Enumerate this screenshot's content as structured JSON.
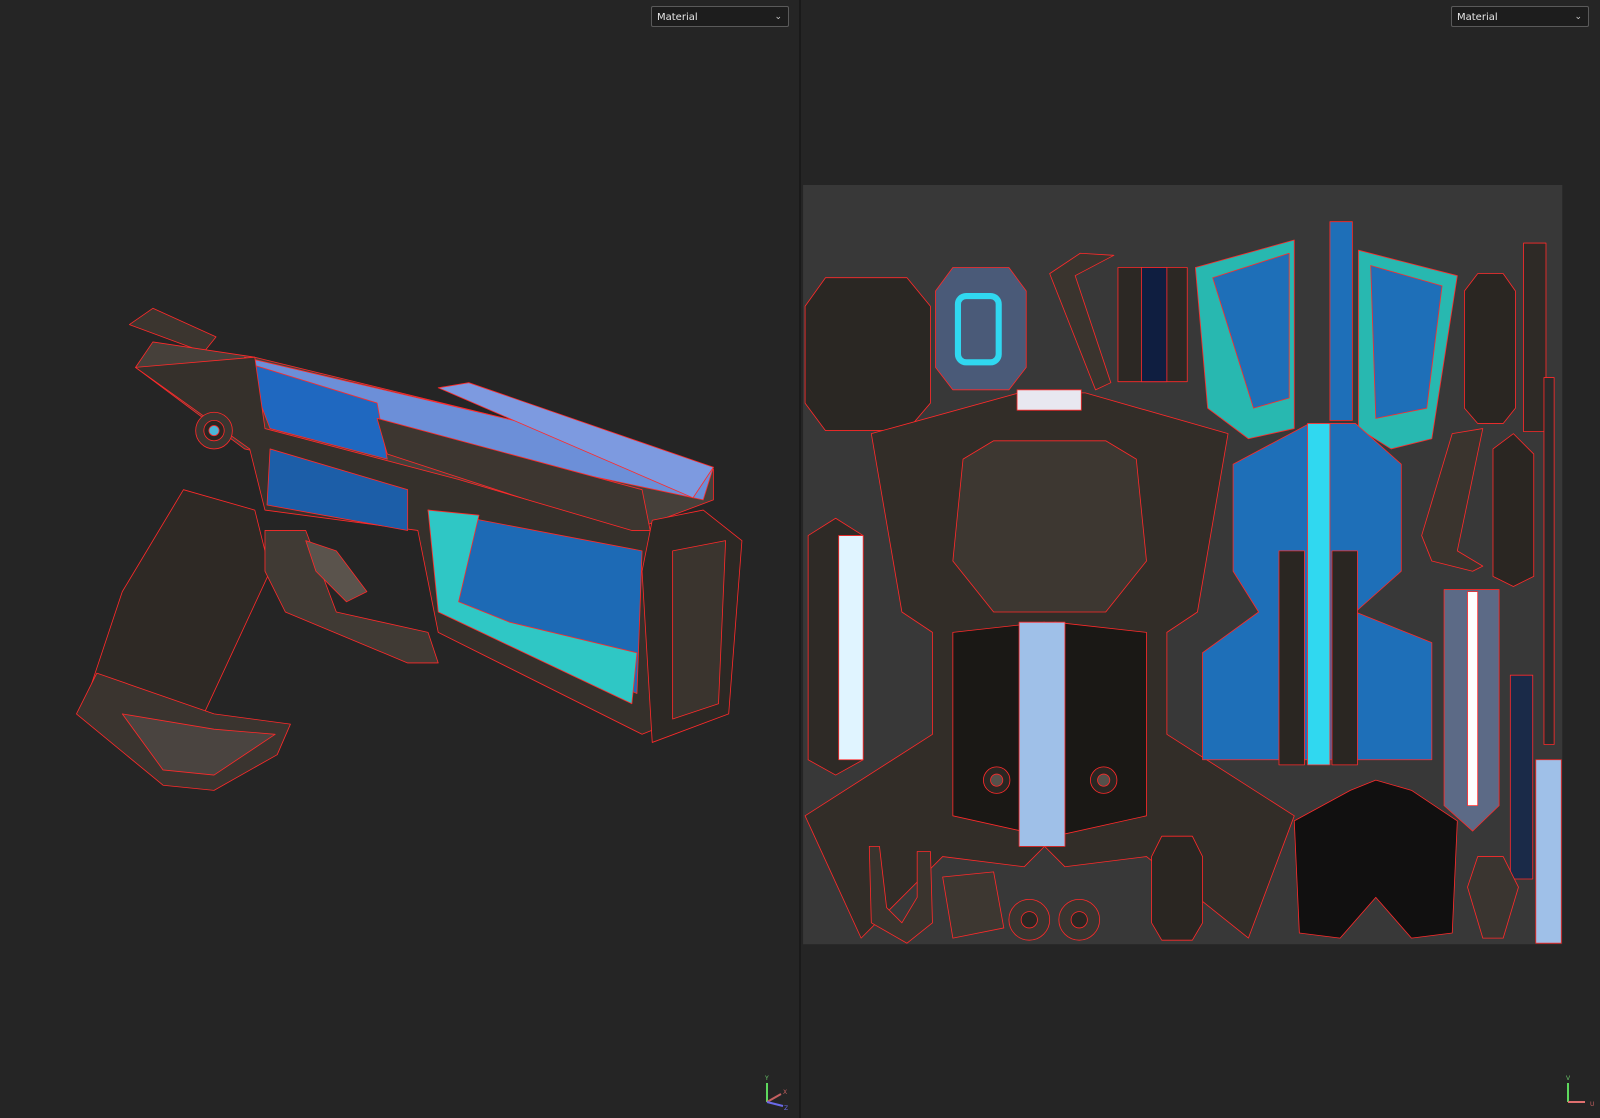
{
  "viewport_3d": {
    "shading_dropdown": {
      "selected": "Material"
    },
    "axis_gizmo": {
      "labels": [
        "Y",
        "X",
        "Z"
      ]
    }
  },
  "viewport_uv": {
    "shading_dropdown": {
      "selected": "Material"
    },
    "axis_gizmo": {
      "labels": [
        "V",
        "U"
      ]
    }
  },
  "colors": {
    "background": "#252525",
    "wireframe": "#ff2020",
    "metal": "#3a3530",
    "panel_blue": "#1e6fb8",
    "panel_cyan": "#30d8e0",
    "uv_tile": "#383838"
  }
}
